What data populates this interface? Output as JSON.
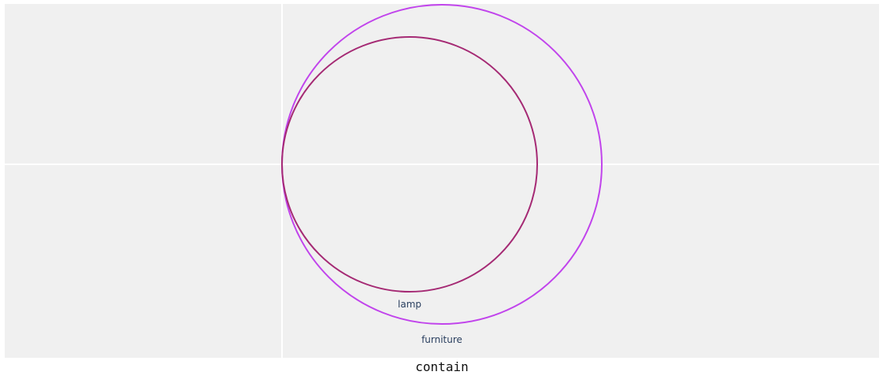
{
  "diagram": {
    "relation": "contain",
    "colors": {
      "background": "#f0f0f0",
      "grid": "#ffffff",
      "outer_circle": "#c144ec",
      "inner_circle": "#a52a74",
      "label_text": "#2a3f5f"
    },
    "sets": [
      {
        "name": "furniture",
        "role": "container"
      },
      {
        "name": "lamp",
        "role": "contained"
      }
    ]
  }
}
